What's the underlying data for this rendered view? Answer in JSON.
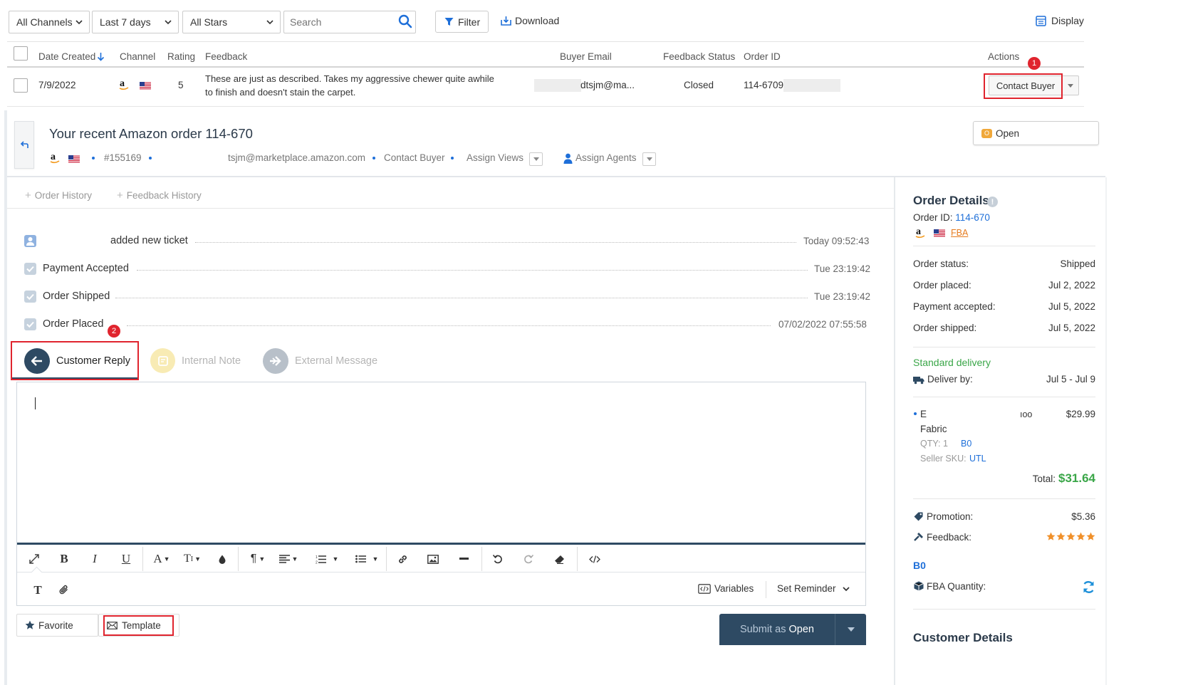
{
  "toolbar": {
    "channel_select": "All Channels",
    "date_select": "Last 7 days",
    "stars_select": "All Stars",
    "search_placeholder": "Search",
    "filter_label": "Filter",
    "download_label": "Download",
    "display_label": "Display"
  },
  "table": {
    "headers": {
      "date_created": "Date Created",
      "channel": "Channel",
      "rating": "Rating",
      "feedback": "Feedback",
      "buyer_email": "Buyer Email",
      "feedback_status": "Feedback Status",
      "order_id": "Order ID",
      "actions": "Actions"
    },
    "row": {
      "date": "7/9/2022",
      "rating": "5",
      "feedback_line1": "These are just as described. Takes my aggressive chewer quite awhile",
      "feedback_line2": "to finish and doesn't stain the carpet.",
      "buyer_email": "dtsjm@ma...",
      "status": "Closed",
      "order_id": "114-6709",
      "action_button": "Contact Buyer"
    }
  },
  "annotations": {
    "badge1": "1",
    "badge2": "2"
  },
  "ticket": {
    "title": "Your recent Amazon order 114-670",
    "ticket_number": "#155169",
    "email": "tsjm@marketplace.amazon.com",
    "contact_buyer": "Contact Buyer",
    "assign_views": "Assign Views",
    "assign_agents": "Assign Agents",
    "status_letter": "O",
    "status_label": "Open"
  },
  "history_tabs": {
    "order_history": "Order History",
    "feedback_history": "Feedback History"
  },
  "timeline": [
    {
      "label": "added new ticket",
      "time": "Today 09:52:43"
    },
    {
      "label": "Payment Accepted",
      "time": "Tue 23:19:42"
    },
    {
      "label": "Order Shipped",
      "time": "Tue 23:19:42"
    },
    {
      "label": "Order Placed",
      "time": "07/02/2022 07:55:58"
    }
  ],
  "reply_tabs": {
    "customer_reply": "Customer Reply",
    "internal_note": "Internal Note",
    "external_message": "External Message"
  },
  "editor": {
    "variables_label": "Variables",
    "reminder_label": "Set Reminder",
    "favorite_label": "Favorite",
    "template_label": "Template",
    "submit_prefix": "Submit as",
    "submit_status": "Open"
  },
  "order_details": {
    "title": "Order Details",
    "order_id_label": "Order ID:",
    "order_id_value": "114-670",
    "fulfillment": "FBA",
    "rows": [
      {
        "label": "Order status:",
        "value": "Shipped"
      },
      {
        "label": "Order placed:",
        "value": "Jul 2, 2022"
      },
      {
        "label": "Payment accepted:",
        "value": "Jul 5, 2022"
      },
      {
        "label": "Order shipped:",
        "value": "Jul 5, 2022"
      }
    ],
    "delivery_type": "Standard delivery",
    "deliver_by_label": "Deliver by:",
    "deliver_by_value": "Jul 5 - Jul 9",
    "item": {
      "name_start": "E",
      "name_end": "ıoo",
      "price": "$29.99",
      "name_line2": "Fabric",
      "qty": "QTY: 1",
      "asin": "B0",
      "sku_label": "Seller SKU:",
      "sku_value": "UTL"
    },
    "total_label": "Total:",
    "total_value": "$31.64",
    "promotion_label": "Promotion:",
    "promotion_value": "$5.36",
    "feedback_label": "Feedback:",
    "feedback_stars": 5,
    "asin_heading": "B0",
    "fba_qty_label": "FBA Quantity:"
  },
  "customer_details_title": "Customer Details",
  "colors": {
    "accent": "#1e6fd9",
    "dark_navy": "#2e4a63",
    "green": "#3aa648",
    "star": "#f0902a",
    "red": "#e0242e"
  }
}
